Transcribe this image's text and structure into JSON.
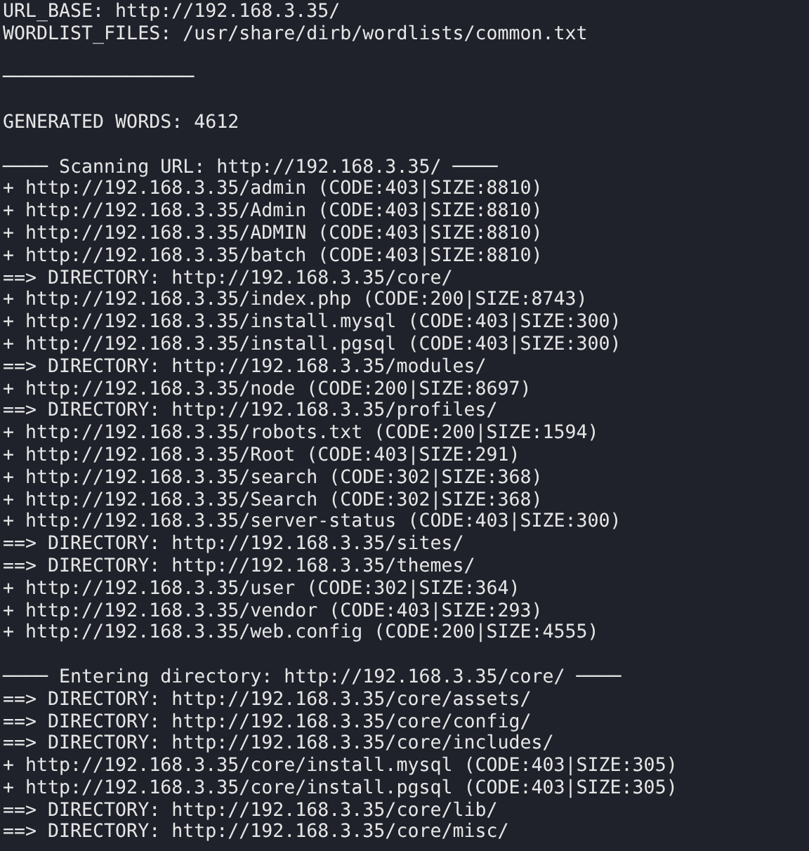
{
  "terminal": {
    "lines": [
      {
        "kind": "text",
        "text": "URL_BASE: http://192.168.3.35/"
      },
      {
        "kind": "text",
        "text": "WORDLIST_FILES: /usr/share/dirb/wordlists/common.txt"
      },
      {
        "kind": "blank"
      },
      {
        "kind": "rule",
        "text": "─────────────────"
      },
      {
        "kind": "blank"
      },
      {
        "kind": "text",
        "text": "GENERATED WORDS: 4612"
      },
      {
        "kind": "blank"
      },
      {
        "kind": "text",
        "text": "──── Scanning URL: http://192.168.3.35/ ────"
      },
      {
        "kind": "text",
        "text": "+ http://192.168.3.35/admin (CODE:403|SIZE:8810)"
      },
      {
        "kind": "text",
        "text": "+ http://192.168.3.35/Admin (CODE:403|SIZE:8810)"
      },
      {
        "kind": "text",
        "text": "+ http://192.168.3.35/ADMIN (CODE:403|SIZE:8810)"
      },
      {
        "kind": "text",
        "text": "+ http://192.168.3.35/batch (CODE:403|SIZE:8810)"
      },
      {
        "kind": "text",
        "text": "==> DIRECTORY: http://192.168.3.35/core/"
      },
      {
        "kind": "text",
        "text": "+ http://192.168.3.35/index.php (CODE:200|SIZE:8743)"
      },
      {
        "kind": "text",
        "text": "+ http://192.168.3.35/install.mysql (CODE:403|SIZE:300)"
      },
      {
        "kind": "text",
        "text": "+ http://192.168.3.35/install.pgsql (CODE:403|SIZE:300)"
      },
      {
        "kind": "text",
        "text": "==> DIRECTORY: http://192.168.3.35/modules/"
      },
      {
        "kind": "text",
        "text": "+ http://192.168.3.35/node (CODE:200|SIZE:8697)"
      },
      {
        "kind": "text",
        "text": "==> DIRECTORY: http://192.168.3.35/profiles/"
      },
      {
        "kind": "text",
        "text": "+ http://192.168.3.35/robots.txt (CODE:200|SIZE:1594)"
      },
      {
        "kind": "text",
        "text": "+ http://192.168.3.35/Root (CODE:403|SIZE:291)"
      },
      {
        "kind": "text",
        "text": "+ http://192.168.3.35/search (CODE:302|SIZE:368)"
      },
      {
        "kind": "text",
        "text": "+ http://192.168.3.35/Search (CODE:302|SIZE:368)"
      },
      {
        "kind": "text",
        "text": "+ http://192.168.3.35/server-status (CODE:403|SIZE:300)"
      },
      {
        "kind": "text",
        "text": "==> DIRECTORY: http://192.168.3.35/sites/"
      },
      {
        "kind": "text",
        "text": "==> DIRECTORY: http://192.168.3.35/themes/"
      },
      {
        "kind": "text",
        "text": "+ http://192.168.3.35/user (CODE:302|SIZE:364)"
      },
      {
        "kind": "text",
        "text": "+ http://192.168.3.35/vendor (CODE:403|SIZE:293)"
      },
      {
        "kind": "text",
        "text": "+ http://192.168.3.35/web.config (CODE:200|SIZE:4555)"
      },
      {
        "kind": "blank"
      },
      {
        "kind": "text",
        "text": "──── Entering directory: http://192.168.3.35/core/ ────"
      },
      {
        "kind": "text",
        "text": "==> DIRECTORY: http://192.168.3.35/core/assets/"
      },
      {
        "kind": "text",
        "text": "==> DIRECTORY: http://192.168.3.35/core/config/"
      },
      {
        "kind": "text",
        "text": "==> DIRECTORY: http://192.168.3.35/core/includes/"
      },
      {
        "kind": "text",
        "text": "+ http://192.168.3.35/core/install.mysql (CODE:403|SIZE:305)"
      },
      {
        "kind": "text",
        "text": "+ http://192.168.3.35/core/install.pgsql (CODE:403|SIZE:305)"
      },
      {
        "kind": "text",
        "text": "==> DIRECTORY: http://192.168.3.35/core/lib/"
      },
      {
        "kind": "text",
        "text": "==> DIRECTORY: http://192.168.3.35/core/misc/"
      }
    ]
  }
}
